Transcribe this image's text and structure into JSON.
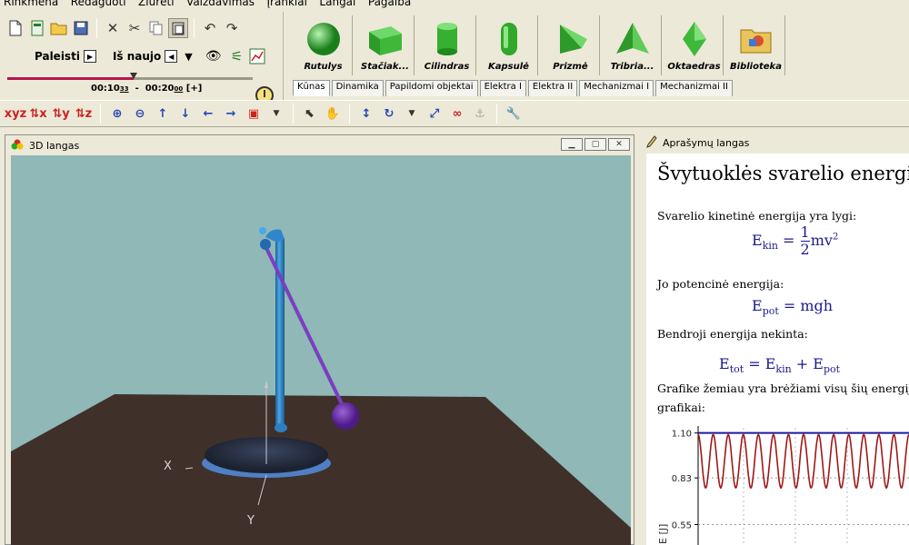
{
  "menu": [
    "Rinkmena",
    "Redaguoti",
    "Žiūrėti",
    "Vaizdavimas",
    "Įrankiai",
    "Langai",
    "Pagalba"
  ],
  "controls": {
    "play_label": "Paleisti",
    "reset_label": "Iš naujo"
  },
  "timeline": {
    "current": "00:10",
    "current_frac": "33",
    "separator": "-",
    "end": "00:20",
    "end_frac": "00",
    "expand": "[+]",
    "progress": 0.516
  },
  "objects": [
    "Rutulys",
    "Stačiak...",
    "Cilindras",
    "Kapsulė",
    "Prizmė",
    "Tribria...",
    "Oktaedras",
    "Biblioteka"
  ],
  "tabs": [
    "Kūnas",
    "Dinamika",
    "Papildomi objektai",
    "Elektra I",
    "Elektra II",
    "Mechanizmai I",
    "Mechanizmai II"
  ],
  "window3d": {
    "title": "3D langas",
    "axis_x": "X",
    "axis_y": "Y"
  },
  "desc": {
    "window_title": "Aprašymų langas",
    "heading": "Švytuoklės svarelio energija",
    "p1": "Svarelio kinetinė energija yra lygi:",
    "f_kin": {
      "lhs": "E",
      "lhs_sub": "kin",
      "num": "1",
      "den": "2",
      "rhs": "mv",
      "rhs_sup": "2"
    },
    "p2": "Jo potencinė energija:",
    "f_pot": {
      "lhs": "E",
      "lhs_sub": "pot",
      "rhs": "mgh"
    },
    "p3": "Bendroji energija nekinta:",
    "f_tot": {
      "lhs": "E",
      "lhs_sub": "tot",
      "a": "E",
      "a_sub": "kin",
      "b": "E",
      "b_sub": "pot"
    },
    "p4a": "Grafike žemiau yra brėžiami visų šių energijų",
    "p4b": "grafikai:"
  },
  "chart_data": {
    "type": "line",
    "ylabel": "E [J]",
    "yticks": [
      "1.10",
      "0.83",
      "0.55"
    ],
    "ylim": [
      0.4,
      1.12
    ],
    "series": [
      {
        "color": "#1a1aa0",
        "kind": "constant",
        "value": 1.1
      },
      {
        "color": "#a01818",
        "kind": "oscillation",
        "min": 0.77,
        "max": 1.09,
        "cycles": 14
      }
    ],
    "grid": true
  }
}
